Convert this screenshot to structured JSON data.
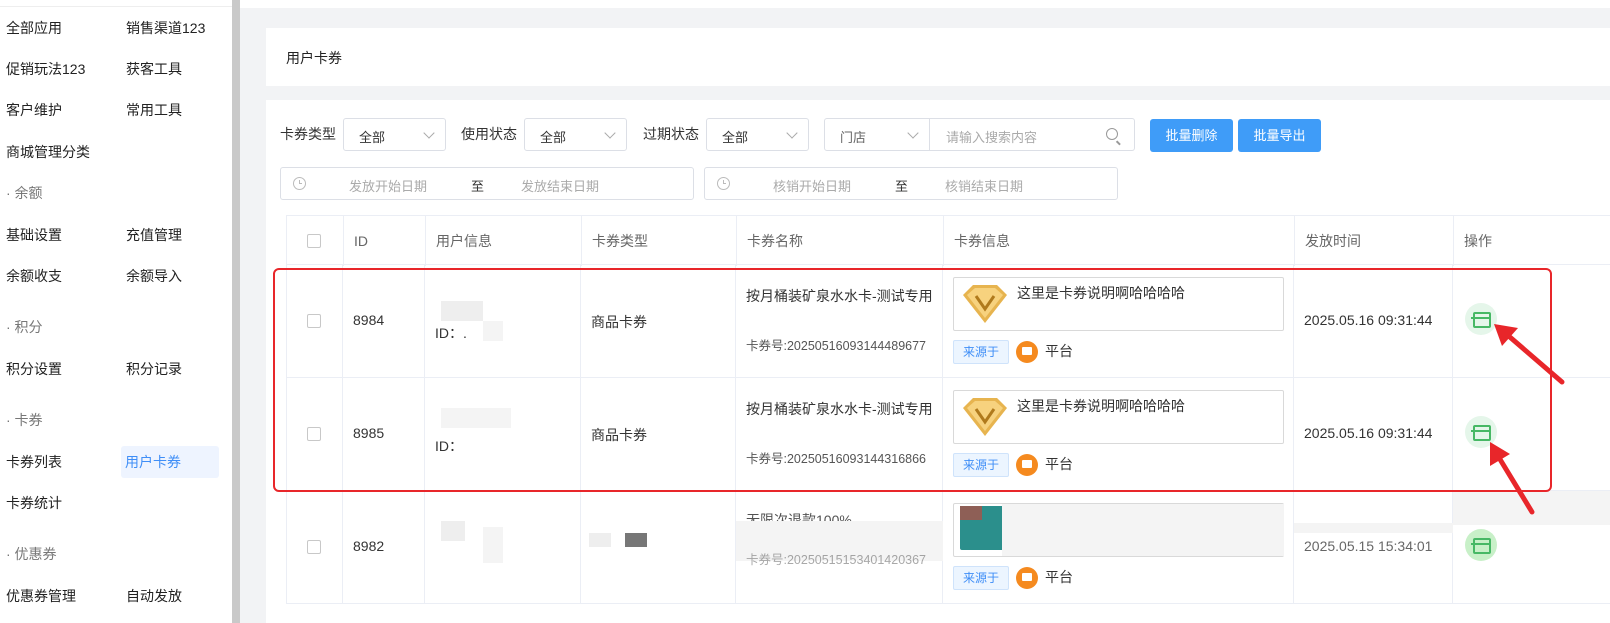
{
  "sidebar": {
    "rows": [
      [
        "全部应用",
        "销售渠道123"
      ],
      [
        "促销玩法123",
        "获客工具"
      ],
      [
        "客户维护",
        "常用工具"
      ],
      [
        "商城管理分类",
        ""
      ]
    ],
    "group_balance": "· 余额",
    "balance_rows": [
      [
        "基础设置",
        "充值管理"
      ],
      [
        "余额收支",
        "余额导入"
      ]
    ],
    "group_points": "· 积分",
    "points_rows": [
      [
        "积分设置",
        "积分记录"
      ]
    ],
    "group_card": "· 卡券",
    "card_rows": [
      [
        "卡券列表",
        "用户卡券"
      ],
      [
        "卡券统计",
        ""
      ]
    ],
    "group_coupon": "· 优惠券",
    "coupon_rows": [
      [
        "优惠券管理",
        "自动发放"
      ]
    ]
  },
  "page": {
    "title": "用户卡券"
  },
  "filters": {
    "card_type_label": "卡券类型",
    "card_type_value": "全部",
    "use_status_label": "使用状态",
    "use_status_value": "全部",
    "expire_status_label": "过期状态",
    "expire_status_value": "全部",
    "store_value": "门店",
    "search_placeholder": "请输入搜索内容",
    "batch_delete": "批量删除",
    "batch_export": "批量导出",
    "issue_start": "发放开始日期",
    "issue_end": "发放结束日期",
    "verify_start": "核销开始日期",
    "verify_end": "核销结束日期",
    "to": "至"
  },
  "table": {
    "headers": [
      "ID",
      "用户信息",
      "卡券类型",
      "卡券名称",
      "卡券信息",
      "发放时间",
      "操作"
    ],
    "rows": [
      {
        "id": "8984",
        "user_id": "ID：.",
        "type": "商品卡券",
        "name": "按月桶装矿泉水水卡-测试专用",
        "no": "卡券号:20250516093144489677",
        "desc": "这里是卡券说明啊哈哈哈哈",
        "source": "来源于",
        "platform": "平台",
        "time": "2025.05.16 09:31:44"
      },
      {
        "id": "8985",
        "user_id": "ID：",
        "type": "商品卡券",
        "name": "按月桶装矿泉水水卡-测试专用",
        "no": "卡券号:20250516093144316866",
        "desc": "这里是卡券说明啊哈哈哈哈",
        "source": "来源于",
        "platform": "平台",
        "time": "2025.05.16 09:31:44"
      },
      {
        "id": "8982",
        "user_id": "",
        "type": "",
        "name": "无限次退款100%",
        "no": "卡券号:20250515153401420367",
        "desc": "",
        "source": "来源于",
        "platform": "平台",
        "time": "2025.05.15 15:34:01"
      }
    ]
  }
}
